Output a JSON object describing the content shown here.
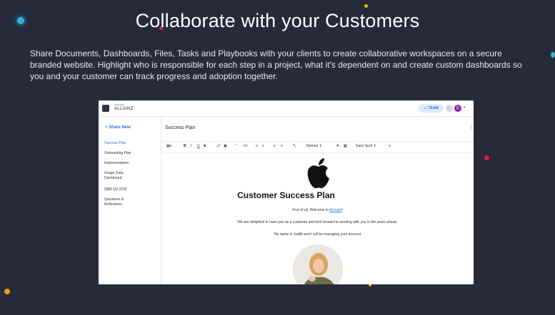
{
  "hero": {
    "title": "Collaborate with your Customers",
    "description": "Share Documents, Dashboards, Files, Tasks and Playbooks with your clients to create collaborative workspaces on a secure branded website. Highlight who is responsible for each step in a project, what it's dependent on and create custom dashboards so you and your customer can track progress and adoption together."
  },
  "colors": {
    "background": "#272a3b",
    "accent_blue": "#2f6fde",
    "avatar_purple": "#8e24aa",
    "dot_red": "#e8173f",
    "dot_orange": "#f39c12",
    "dot_cyan": "#36b3d6"
  },
  "app": {
    "brand_small": "Arrivate",
    "brand_name": "ALLIANZ",
    "team_label": "TEAM",
    "avatar_initial": "C",
    "share_new": "Share New",
    "sidebar_items": [
      "Success Plan",
      "Onboarding Plan",
      "Implementation",
      "Usage Data Dashboard",
      "QBR Q3 2019",
      "Questions & Reflections"
    ],
    "doc_title": "Success Plan",
    "toolbar": {
      "bold": "B",
      "italic": "I",
      "underline": "U",
      "strike": "S",
      "format_select": "Normal",
      "font_select": "Sans Serif",
      "text_color": "A"
    },
    "plan_title": "Customer Success Plan",
    "welcome_prefix": "First of all, Welcome to ",
    "welcome_link": "Arrivate",
    "welcome_suffix": "!",
    "line2": "We are delighted to have you as a customer and look forward to working with you in the years ahead.",
    "line3": "My name is Judith and I will be managing your account"
  }
}
